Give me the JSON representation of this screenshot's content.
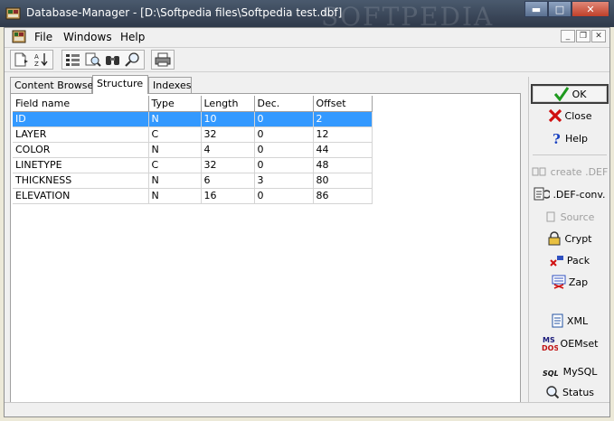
{
  "window": {
    "title": "Database-Manager - [D:\\Softpedia files\\Softpedia test.dbf]",
    "watermark": "SOFTPEDIA",
    "controls": {
      "minimize": "▬",
      "maximize": "□",
      "close": "✕"
    }
  },
  "menu": {
    "items": [
      "File",
      "Windows",
      "Help"
    ],
    "mdi_controls": {
      "minimize": "_",
      "restore": "❐",
      "close": "✕"
    }
  },
  "toolbar": {
    "icons": [
      "new-file-icon",
      "sort-az-icon",
      "grid-view-icon",
      "search-doc-icon",
      "binoculars-icon",
      "zoom-icon",
      "printer-icon"
    ]
  },
  "tabs": [
    {
      "label": "Content Browser",
      "active": false
    },
    {
      "label": "Structure",
      "active": true
    },
    {
      "label": "Indexes",
      "active": false
    }
  ],
  "table": {
    "columns": [
      "Field name",
      "Type",
      "Length",
      "Dec.",
      "Offset"
    ],
    "rows": [
      [
        "ID",
        "N",
        "10",
        "0",
        "2"
      ],
      [
        "LAYER",
        "C",
        "32",
        "0",
        "12"
      ],
      [
        "COLOR",
        "N",
        "4",
        "0",
        "44"
      ],
      [
        "LINETYPE",
        "C",
        "32",
        "0",
        "48"
      ],
      [
        "THICKNESS",
        "N",
        "6",
        "3",
        "80"
      ],
      [
        "ELEVATION",
        "N",
        "16",
        "0",
        "86"
      ]
    ],
    "selected_row": 0
  },
  "side": {
    "ok": "OK",
    "close": "Close",
    "help": "Help",
    "create_def": "create .DEF",
    "def_conv": ".DEF-conv.",
    "source": "Source",
    "crypt": "Crypt",
    "pack": "Pack",
    "zap": "Zap",
    "xml": "XML",
    "oemset": "OEMset",
    "mysql": "MySQL",
    "status": "Status"
  },
  "colors": {
    "selection": "#3399ff",
    "titlebar": "#3a4658"
  }
}
